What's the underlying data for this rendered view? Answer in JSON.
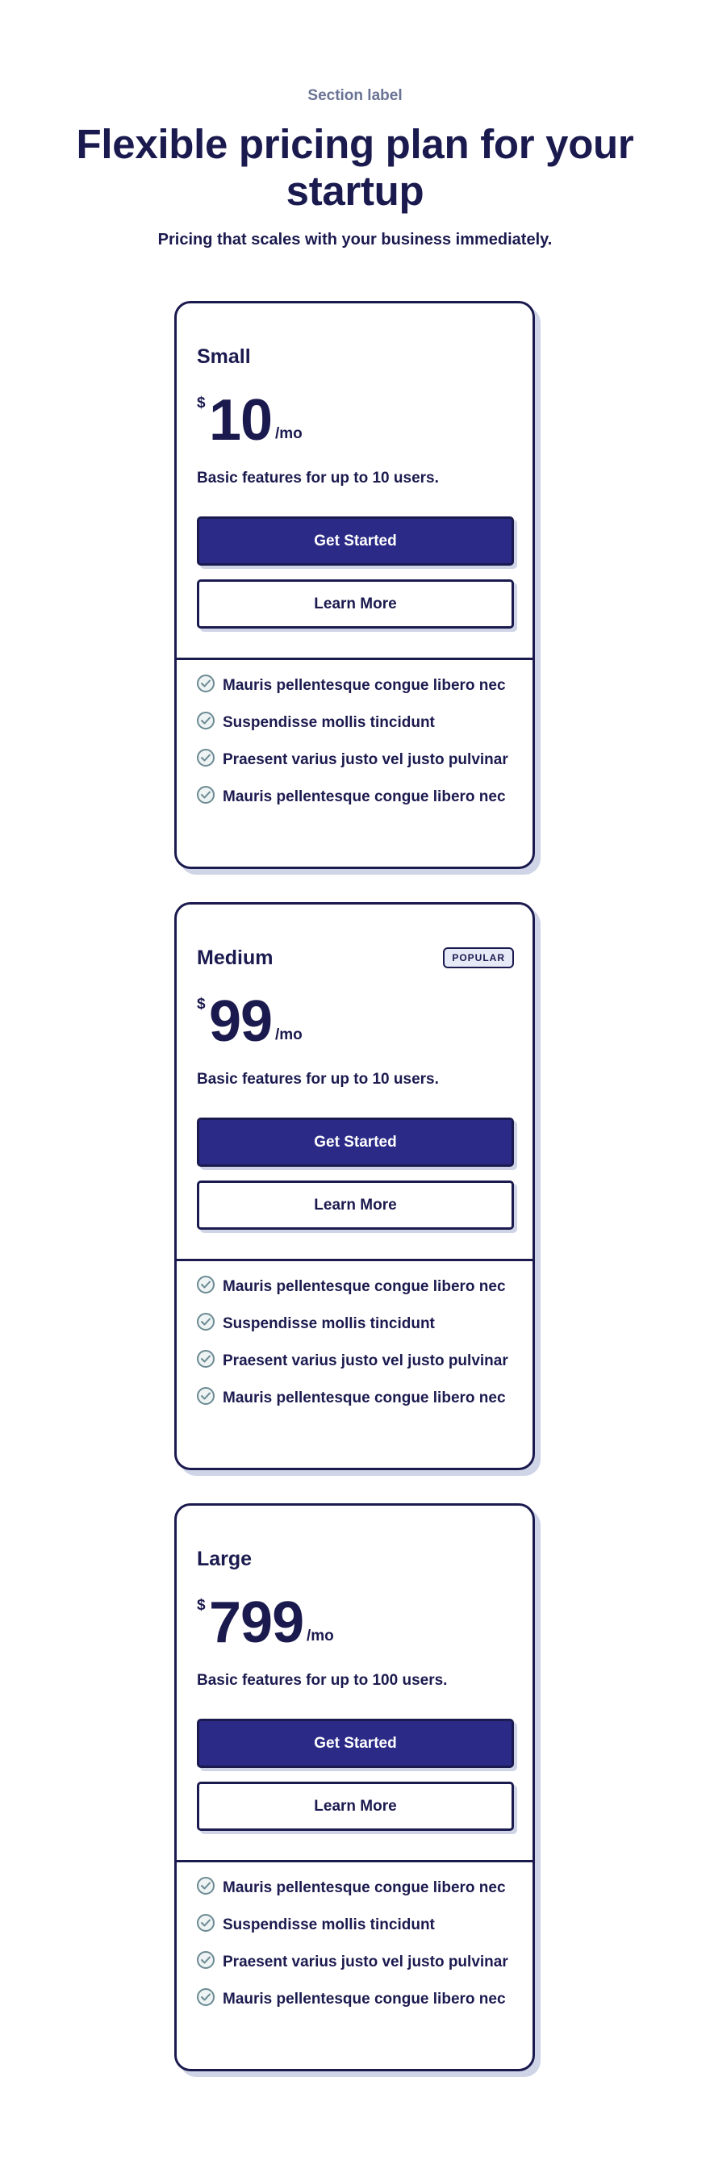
{
  "header": {
    "section_label": "Section label",
    "title": "Flexible pricing plan for your startup",
    "subtitle": "Pricing that scales with your business immediately."
  },
  "plans": [
    {
      "name": "Small",
      "badge": "",
      "currency": "$",
      "price": "10",
      "period": "/mo",
      "description": "Basic features for up to 10 users.",
      "primary_label": "Get Started",
      "secondary_label": "Learn More",
      "features": [
        "Mauris pellentesque congue libero nec",
        "Suspendisse mollis tincidunt",
        "Praesent varius justo vel justo pulvinar",
        "Mauris pellentesque congue libero nec"
      ]
    },
    {
      "name": "Medium",
      "badge": "POPULAR",
      "currency": "$",
      "price": "99",
      "period": "/mo",
      "description": "Basic features for up to 10 users.",
      "primary_label": "Get Started",
      "secondary_label": "Learn More",
      "features": [
        "Mauris pellentesque congue libero nec",
        "Suspendisse mollis tincidunt",
        "Praesent varius justo vel justo pulvinar",
        "Mauris pellentesque congue libero nec"
      ]
    },
    {
      "name": "Large",
      "badge": "",
      "currency": "$",
      "price": "799",
      "period": "/mo",
      "description": "Basic features for up to 100 users.",
      "primary_label": "Get Started",
      "secondary_label": "Learn More",
      "features": [
        "Mauris pellentesque congue libero nec",
        "Suspendisse mollis tincidunt",
        "Praesent varius justo vel justo pulvinar",
        "Mauris pellentesque congue libero nec"
      ]
    }
  ],
  "colors": {
    "text": "#1b1a4f",
    "label": "#6b7394",
    "primary_button": "#2b2a86",
    "shadow": "#cfd4e6",
    "check": "#6b8a92"
  },
  "icons": {
    "feature": "check-circle-icon"
  }
}
